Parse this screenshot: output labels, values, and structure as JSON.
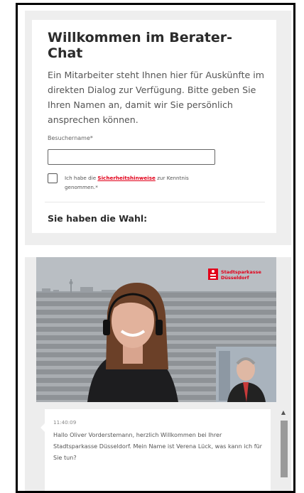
{
  "form": {
    "title": "Willkommen im Berater-Chat",
    "intro": "Ein Mitarbeiter steht Ihnen hier für Auskünfte im direkten Dialog zur Verfügung. Bitte geben Sie Ihren Namen an, damit wir Sie persönlich ansprechen können.",
    "name_label": "Besuchername*",
    "name_value": "",
    "consent_prefix": "Ich habe die ",
    "consent_link": "Sicherheitshinweise",
    "consent_suffix": " zur Kenntnis genommen.*",
    "choice_heading": "Sie haben die Wahl:"
  },
  "video": {
    "brand_line1": "Stadtsparkasse",
    "brand_line2": "Düsseldorf"
  },
  "chat": {
    "time": "11:40:09",
    "message": "Hallo Oliver Vorderstemann, herzlich Willkommen bei Ihrer Stadtsparkasse Düsseldorf. Mein Name ist Verena Lück, was kann ich für Sie tun?"
  },
  "icons": {
    "scroll_up": "▲"
  },
  "colors": {
    "brand_red": "#e2001a",
    "chat_bg": "#ededed"
  }
}
